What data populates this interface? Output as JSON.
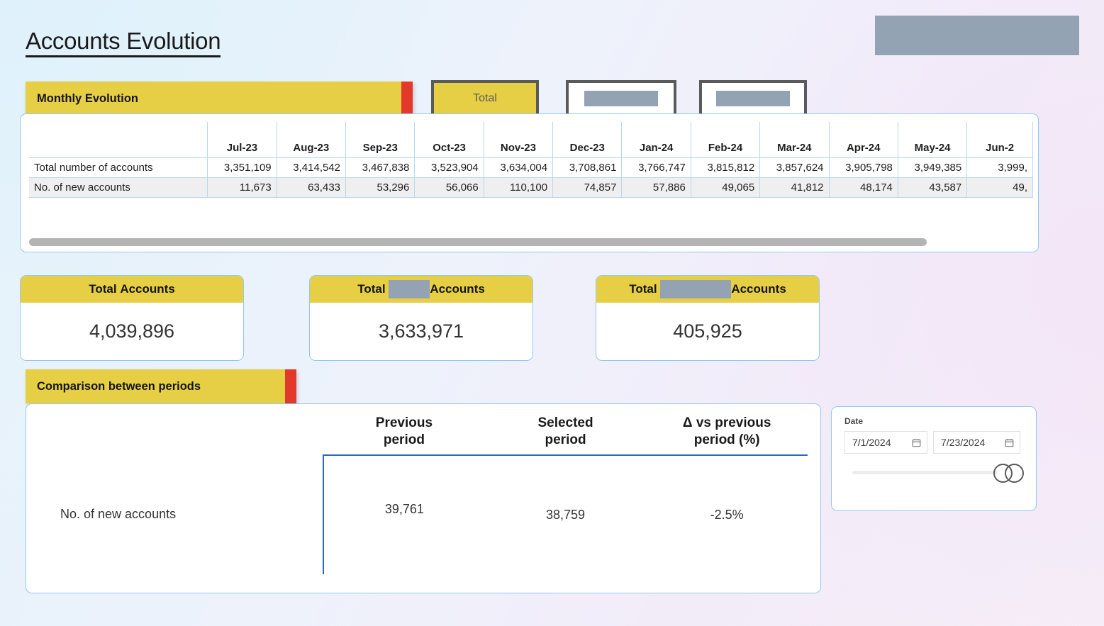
{
  "page": {
    "title": "Accounts Evolution"
  },
  "logo_placeholder": {
    "redacted": true
  },
  "monthly_section": {
    "banner_label": "Monthly Evolution",
    "filters": [
      {
        "label": "Total",
        "selected": true,
        "redacted": false
      },
      {
        "label": "",
        "selected": false,
        "redacted": true
      },
      {
        "label": "",
        "selected": false,
        "redacted": true
      }
    ]
  },
  "chart_data": {
    "type": "table",
    "title": "Monthly Evolution",
    "columns": [
      "",
      "Jul-23",
      "Aug-23",
      "Sep-23",
      "Oct-23",
      "Nov-23",
      "Dec-23",
      "Jan-24",
      "Feb-24",
      "Mar-24",
      "Apr-24",
      "May-24",
      "Jun-2"
    ],
    "categories": [
      "Jul-23",
      "Aug-23",
      "Sep-23",
      "Oct-23",
      "Nov-23",
      "Dec-23",
      "Jan-24",
      "Feb-24",
      "Mar-24",
      "Apr-24",
      "May-24",
      "Jun-2"
    ],
    "rows": [
      {
        "label": "Total number of accounts",
        "values": [
          "3,351,109",
          "3,414,542",
          "3,467,838",
          "3,523,904",
          "3,634,004",
          "3,708,861",
          "3,766,747",
          "3,815,812",
          "3,857,624",
          "3,905,798",
          "3,949,385",
          "3,999,"
        ]
      },
      {
        "label": "No. of new accounts",
        "values": [
          "11,673",
          "63,433",
          "53,296",
          "56,066",
          "110,100",
          "74,857",
          "57,886",
          "49,065",
          "41,812",
          "48,174",
          "43,587",
          "49,"
        ]
      }
    ],
    "series": [
      {
        "name": "Total number of accounts",
        "values": [
          3351109,
          3414542,
          3467838,
          3523904,
          3634004,
          3708861,
          3766747,
          3815812,
          3857624,
          3905798,
          3949385,
          null
        ]
      },
      {
        "name": "No. of new accounts",
        "values": [
          11673,
          63433,
          53296,
          56066,
          110100,
          74857,
          57886,
          49065,
          41812,
          48174,
          43587,
          null
        ]
      }
    ],
    "note": "Last column (Jun-2...) is horizontally clipped by the scroll viewport",
    "scroll": {
      "horizontal": true,
      "thumb_fraction": 0.9
    }
  },
  "kpi_cards": [
    {
      "title_prefix": "Total",
      "title_redacted": false,
      "title_suffix": "Accounts",
      "value": "4,039,896"
    },
    {
      "title_prefix": "Total",
      "title_redacted": true,
      "title_suffix": "Accounts",
      "value": "3,633,971"
    },
    {
      "title_prefix": "Total",
      "title_redacted": true,
      "title_suffix": "Accounts",
      "value": "405,925"
    }
  ],
  "comparison_section": {
    "banner_label": "Comparison between periods",
    "headers": {
      "blank": "",
      "previous": "Previous\nperiod",
      "previous_line1": "Previous",
      "previous_line2": "period",
      "selected_line1": "Selected",
      "selected_line2": "period",
      "delta_line1": "Δ vs previous",
      "delta_line2": "period (%)"
    },
    "rows": [
      {
        "label": "No. of new accounts",
        "previous_period": "39,761",
        "selected_period": "38,759",
        "delta_vs_previous_pct": "-2.5%"
      }
    ]
  },
  "date_slicer": {
    "label": "Date",
    "start_value": "7/1/2024",
    "end_value": "7/23/2024",
    "start_icon": "calendar-icon",
    "end_icon": "calendar-icon",
    "slider_position_pct": 100
  },
  "colors": {
    "accent_yellow": "#E7CF45",
    "accent_red": "#E2392A",
    "card_border_blue": "#93C9F0",
    "divider_blue": "#2A6BB5",
    "redaction_grey": "#94A3B4"
  }
}
